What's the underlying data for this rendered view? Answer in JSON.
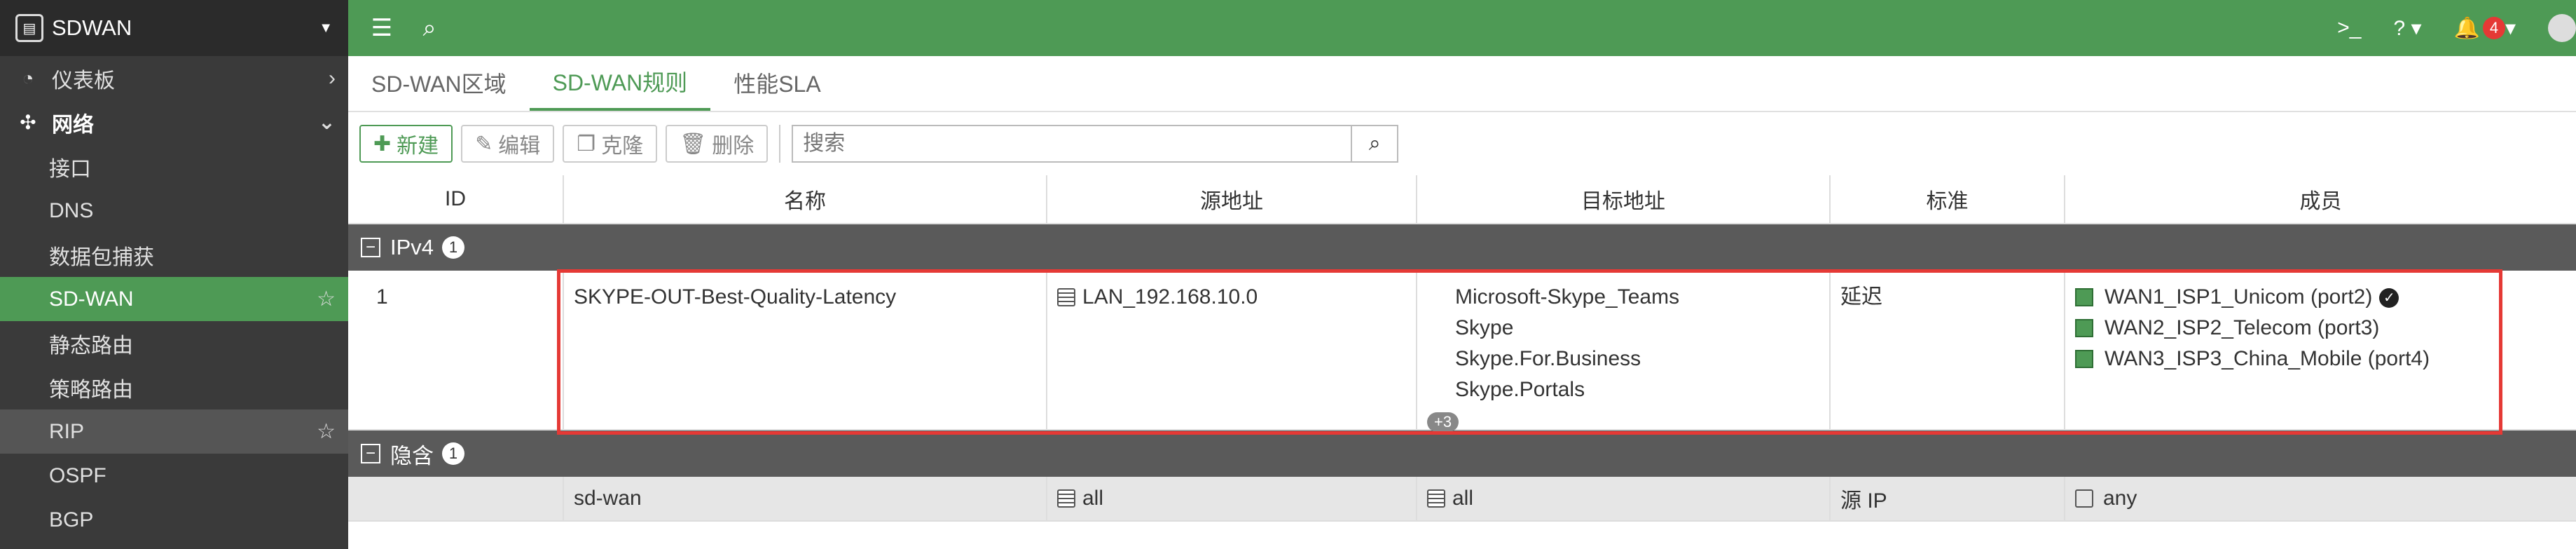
{
  "sidebar": {
    "title": "SDWAN",
    "items": [
      {
        "label": "仪表板",
        "icon": "dashboard-icon"
      },
      {
        "label": "网络",
        "icon": "network-icon"
      },
      {
        "label": "接口"
      },
      {
        "label": "DNS"
      },
      {
        "label": "数据包捕获"
      },
      {
        "label": "SD-WAN"
      },
      {
        "label": "静态路由"
      },
      {
        "label": "策略路由"
      },
      {
        "label": "RIP"
      },
      {
        "label": "OSPF"
      },
      {
        "label": "BGP"
      }
    ]
  },
  "topbar": {
    "notifications": "4"
  },
  "tabs": [
    {
      "label": "SD-WAN区域"
    },
    {
      "label": "SD-WAN规则"
    },
    {
      "label": "性能SLA"
    }
  ],
  "toolbar": {
    "new": "新建",
    "edit": "编辑",
    "clone": "克隆",
    "delete": "删除",
    "search_placeholder": "搜索"
  },
  "table": {
    "columns": [
      "ID",
      "名称",
      "源地址",
      "目标地址",
      "标准",
      "成员"
    ],
    "group_ipv4": {
      "label": "IPv4",
      "count": "1"
    },
    "rule": {
      "id": "1",
      "name": "SKYPE-OUT-Best-Quality-Latency",
      "source": "LAN_192.168.10.0",
      "destinations": [
        "Microsoft-Skype_Teams",
        "Skype",
        "Skype.For.Business",
        "Skype.Portals"
      ],
      "more": "+3",
      "criteria": "延迟",
      "members": [
        "WAN1_ISP1_Unicom (port2)",
        "WAN2_ISP2_Telecom (port3)",
        "WAN3_ISP3_China_Mobile (port4)"
      ]
    },
    "group_implicit": {
      "label": "隐含",
      "count": "1"
    },
    "implicit_row": {
      "name": "sd-wan",
      "source": "all",
      "destination": "all",
      "criteria": "源 IP",
      "member": "any"
    }
  },
  "colors": {
    "brand_green": "#4e9a55",
    "highlight_red": "#e53935"
  }
}
